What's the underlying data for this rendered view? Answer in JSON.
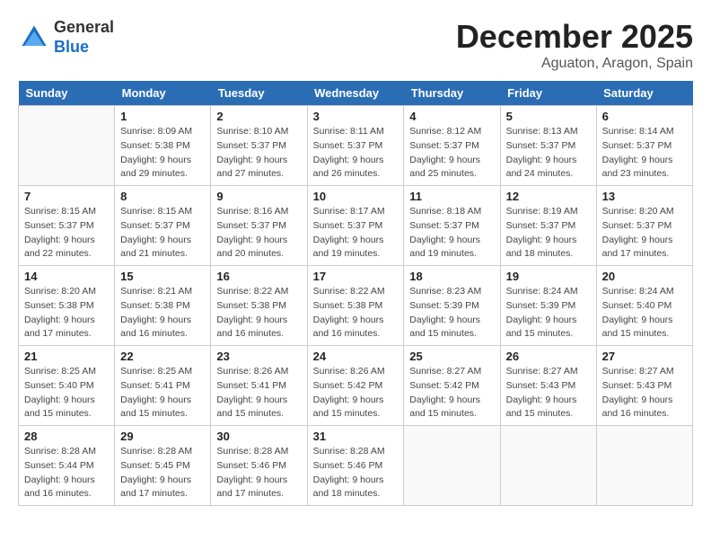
{
  "header": {
    "logo_general": "General",
    "logo_blue": "Blue",
    "month_year": "December 2025",
    "location": "Aguaton, Aragon, Spain"
  },
  "days_of_week": [
    "Sunday",
    "Monday",
    "Tuesday",
    "Wednesday",
    "Thursday",
    "Friday",
    "Saturday"
  ],
  "weeks": [
    [
      {
        "day": "",
        "info": ""
      },
      {
        "day": "1",
        "info": "Sunrise: 8:09 AM\nSunset: 5:38 PM\nDaylight: 9 hours\nand 29 minutes."
      },
      {
        "day": "2",
        "info": "Sunrise: 8:10 AM\nSunset: 5:37 PM\nDaylight: 9 hours\nand 27 minutes."
      },
      {
        "day": "3",
        "info": "Sunrise: 8:11 AM\nSunset: 5:37 PM\nDaylight: 9 hours\nand 26 minutes."
      },
      {
        "day": "4",
        "info": "Sunrise: 8:12 AM\nSunset: 5:37 PM\nDaylight: 9 hours\nand 25 minutes."
      },
      {
        "day": "5",
        "info": "Sunrise: 8:13 AM\nSunset: 5:37 PM\nDaylight: 9 hours\nand 24 minutes."
      },
      {
        "day": "6",
        "info": "Sunrise: 8:14 AM\nSunset: 5:37 PM\nDaylight: 9 hours\nand 23 minutes."
      }
    ],
    [
      {
        "day": "7",
        "info": "Sunrise: 8:15 AM\nSunset: 5:37 PM\nDaylight: 9 hours\nand 22 minutes."
      },
      {
        "day": "8",
        "info": "Sunrise: 8:15 AM\nSunset: 5:37 PM\nDaylight: 9 hours\nand 21 minutes."
      },
      {
        "day": "9",
        "info": "Sunrise: 8:16 AM\nSunset: 5:37 PM\nDaylight: 9 hours\nand 20 minutes."
      },
      {
        "day": "10",
        "info": "Sunrise: 8:17 AM\nSunset: 5:37 PM\nDaylight: 9 hours\nand 19 minutes."
      },
      {
        "day": "11",
        "info": "Sunrise: 8:18 AM\nSunset: 5:37 PM\nDaylight: 9 hours\nand 19 minutes."
      },
      {
        "day": "12",
        "info": "Sunrise: 8:19 AM\nSunset: 5:37 PM\nDaylight: 9 hours\nand 18 minutes."
      },
      {
        "day": "13",
        "info": "Sunrise: 8:20 AM\nSunset: 5:37 PM\nDaylight: 9 hours\nand 17 minutes."
      }
    ],
    [
      {
        "day": "14",
        "info": "Sunrise: 8:20 AM\nSunset: 5:38 PM\nDaylight: 9 hours\nand 17 minutes."
      },
      {
        "day": "15",
        "info": "Sunrise: 8:21 AM\nSunset: 5:38 PM\nDaylight: 9 hours\nand 16 minutes."
      },
      {
        "day": "16",
        "info": "Sunrise: 8:22 AM\nSunset: 5:38 PM\nDaylight: 9 hours\nand 16 minutes."
      },
      {
        "day": "17",
        "info": "Sunrise: 8:22 AM\nSunset: 5:38 PM\nDaylight: 9 hours\nand 16 minutes."
      },
      {
        "day": "18",
        "info": "Sunrise: 8:23 AM\nSunset: 5:39 PM\nDaylight: 9 hours\nand 15 minutes."
      },
      {
        "day": "19",
        "info": "Sunrise: 8:24 AM\nSunset: 5:39 PM\nDaylight: 9 hours\nand 15 minutes."
      },
      {
        "day": "20",
        "info": "Sunrise: 8:24 AM\nSunset: 5:40 PM\nDaylight: 9 hours\nand 15 minutes."
      }
    ],
    [
      {
        "day": "21",
        "info": "Sunrise: 8:25 AM\nSunset: 5:40 PM\nDaylight: 9 hours\nand 15 minutes."
      },
      {
        "day": "22",
        "info": "Sunrise: 8:25 AM\nSunset: 5:41 PM\nDaylight: 9 hours\nand 15 minutes."
      },
      {
        "day": "23",
        "info": "Sunrise: 8:26 AM\nSunset: 5:41 PM\nDaylight: 9 hours\nand 15 minutes."
      },
      {
        "day": "24",
        "info": "Sunrise: 8:26 AM\nSunset: 5:42 PM\nDaylight: 9 hours\nand 15 minutes."
      },
      {
        "day": "25",
        "info": "Sunrise: 8:27 AM\nSunset: 5:42 PM\nDaylight: 9 hours\nand 15 minutes."
      },
      {
        "day": "26",
        "info": "Sunrise: 8:27 AM\nSunset: 5:43 PM\nDaylight: 9 hours\nand 15 minutes."
      },
      {
        "day": "27",
        "info": "Sunrise: 8:27 AM\nSunset: 5:43 PM\nDaylight: 9 hours\nand 16 minutes."
      }
    ],
    [
      {
        "day": "28",
        "info": "Sunrise: 8:28 AM\nSunset: 5:44 PM\nDaylight: 9 hours\nand 16 minutes."
      },
      {
        "day": "29",
        "info": "Sunrise: 8:28 AM\nSunset: 5:45 PM\nDaylight: 9 hours\nand 17 minutes."
      },
      {
        "day": "30",
        "info": "Sunrise: 8:28 AM\nSunset: 5:46 PM\nDaylight: 9 hours\nand 17 minutes."
      },
      {
        "day": "31",
        "info": "Sunrise: 8:28 AM\nSunset: 5:46 PM\nDaylight: 9 hours\nand 18 minutes."
      },
      {
        "day": "",
        "info": ""
      },
      {
        "day": "",
        "info": ""
      },
      {
        "day": "",
        "info": ""
      }
    ]
  ]
}
